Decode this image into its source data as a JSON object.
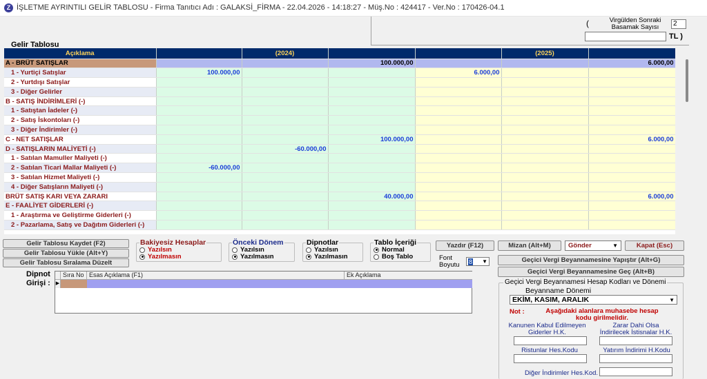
{
  "window": {
    "title": "İŞLETME AYRINTILI GELİR TABLOSU - Firma Tanıtıcı Adı : GALAKSİ_FİRMA - 22.04.2026 - 14:18:27 - Müş.No : 424417 - Ver.No : 170426-04.1",
    "icon_letter": "Z"
  },
  "top": {
    "open_paren": "(",
    "decimal_label": "Virgülden Sonraki Basamak Sayısı",
    "decimal_value": "2",
    "tl_suffix": "TL )",
    "tl_value": ""
  },
  "section_title": "Gelir Tablosu",
  "grid": {
    "headers": {
      "desc": "Açıklama",
      "y2024": "(2024)",
      "y2025": "(2025)"
    },
    "rows": [
      {
        "label": "A - BRÜT SATIŞLAR",
        "c": [
          "",
          "",
          "100.000,00",
          "",
          "",
          "6.000,00"
        ]
      },
      {
        "label": "1 - Yurtiçi Satışlar",
        "c": [
          "100.000,00",
          "",
          "",
          "6.000,00",
          "",
          ""
        ]
      },
      {
        "label": "2 - Yurtdışı Satışlar",
        "c": [
          "",
          "",
          "",
          "",
          "",
          ""
        ]
      },
      {
        "label": "3 - Diğer Gelirler",
        "c": [
          "",
          "",
          "",
          "",
          "",
          ""
        ]
      },
      {
        "label": "B - SATIŞ İNDİRİMLERİ (-)",
        "c": [
          "",
          "",
          "",
          "",
          "",
          ""
        ]
      },
      {
        "label": "1 - Satıştan İadeler (-)",
        "c": [
          "",
          "",
          "",
          "",
          "",
          ""
        ]
      },
      {
        "label": "2 - Satış İskontoları (-)",
        "c": [
          "",
          "",
          "",
          "",
          "",
          ""
        ]
      },
      {
        "label": "3 - Diğer İndirimler (-)",
        "c": [
          "",
          "",
          "",
          "",
          "",
          ""
        ]
      },
      {
        "label": "C - NET SATIŞLAR",
        "c": [
          "",
          "",
          "100.000,00",
          "",
          "",
          "6.000,00"
        ]
      },
      {
        "label": "D - SATIŞLARIN MALİYETİ (-)",
        "c": [
          "",
          "-60.000,00",
          "",
          "",
          "",
          ""
        ]
      },
      {
        "label": "1 - Satılan Mamuller Maliyeti (-)",
        "c": [
          "",
          "",
          "",
          "",
          "",
          ""
        ]
      },
      {
        "label": "2 - Satılan Ticari Mallar Maliyeti (-)",
        "c": [
          "-60.000,00",
          "",
          "",
          "",
          "",
          ""
        ]
      },
      {
        "label": "3 - Satılan Hizmet Maliyeti (-)",
        "c": [
          "",
          "",
          "",
          "",
          "",
          ""
        ]
      },
      {
        "label": "4 - Diğer Satışların Maliyeti (-)",
        "c": [
          "",
          "",
          "",
          "",
          "",
          ""
        ]
      },
      {
        "label": "BRÜT SATIŞ KARI VEYA ZARARI",
        "c": [
          "",
          "",
          "40.000,00",
          "",
          "",
          "6.000,00"
        ]
      },
      {
        "label": "E - FAALİYET GİDERLERİ (-)",
        "c": [
          "",
          "",
          "",
          "",
          "",
          ""
        ]
      },
      {
        "label": "1 - Araştırma ve Geliştirme Giderleri (-)",
        "c": [
          "",
          "",
          "",
          "",
          "",
          ""
        ]
      },
      {
        "label": "2 - Pazarlama, Satış ve Dağıtım Giderleri (-)",
        "c": [
          "",
          "",
          "",
          "",
          "",
          ""
        ]
      }
    ]
  },
  "buttons": {
    "save": "Gelir Tablosu Kaydet (F2)",
    "load": "Gelir Tablosu Yükle (Alt+Y)",
    "order": "Gelir Tablosu Sıralama Düzelt",
    "print": "Yazdır (F12)",
    "mizan": "Mizan (Alt+M)",
    "send": "Gönder",
    "close": "Kapat (Esc)",
    "paste": "Geçici Vergi Beyannamesine Yapıştır  (Alt+G)",
    "goto": "Geçici Vergi Beyannamesine Geç (Alt+B)"
  },
  "options": {
    "bakiyesiz": {
      "title": "Bakiyesiz Hesaplar",
      "opt1": "Yazılsın",
      "opt2": "Yazılmasın"
    },
    "onceki": {
      "title": "Önceki Dönem",
      "opt1": "Yazılsın",
      "opt2": "Yazılmasın"
    },
    "dipnotlar": {
      "title": "Dipnotlar",
      "opt1": "Yazılsın",
      "opt2": "Yazılmasın"
    },
    "tablo": {
      "title": "Tablo İçeriği",
      "opt1": "Normal",
      "opt2": "Boş Tablo"
    }
  },
  "font": {
    "label1": "Font",
    "label2": "Boyutu",
    "value": "8"
  },
  "dipnot": {
    "label1": "Dipnot",
    "label2": "Girişi :",
    "col_sira": "Sıra No",
    "col_esas": "Esas Açıklama (F1)",
    "col_ek": "Ek Açıklama"
  },
  "lower_panel": {
    "title": "Geçici Vergi Beyannamesi Hesap Kodları ve Dönemi",
    "period_label": "Beyanname Dönemi",
    "period_value": "EKİM, KASIM, ARALIK",
    "note_label": "Not :",
    "note_line1": "Aşağıdaki alanlara muhasebe hesap",
    "note_line2": "kodu girilmelidir.",
    "field1_l1": "Kanunen Kabul Edilmeyen",
    "field1_l2": "Giderler H.K.",
    "field2_l1": "Zarar Dahi Olsa",
    "field2_l2": "İndirilecek İstisnalar H.K.",
    "field3": "Ristunlar Hes.Kodu",
    "field4": "Yatırım İndirimi H.Kodu",
    "field5": "Diğer İndirimler Hes.Kod."
  }
}
